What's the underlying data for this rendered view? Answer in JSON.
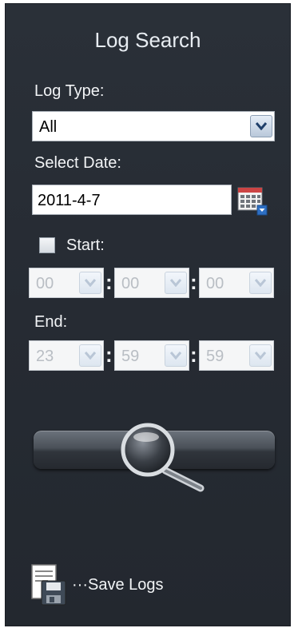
{
  "panel": {
    "title": "Log Search",
    "log_type": {
      "label": "Log Type:",
      "value": "All"
    },
    "date": {
      "label": "Select Date:",
      "value": "2011-4-7"
    },
    "start": {
      "label": "Start:",
      "hour": "00",
      "minute": "00",
      "second": "00",
      "checked": false
    },
    "end": {
      "label": "End:",
      "hour": "23",
      "minute": "59",
      "second": "59"
    },
    "separator": ":",
    "save_label": "···Save Logs"
  },
  "icons": {
    "dropdown": "chevron-down-icon",
    "calendar": "calendar-icon",
    "search": "magnifier-icon",
    "save": "floppy-disk-icon"
  },
  "colors": {
    "panel_bg": "#262b33",
    "text": "#f2f4f6",
    "accent": "#2d6fc4"
  }
}
